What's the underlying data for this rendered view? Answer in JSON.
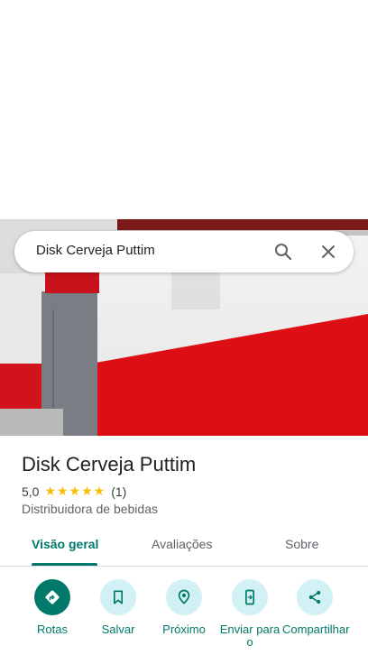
{
  "search": {
    "value": "Disk Cerveja Puttim"
  },
  "place": {
    "name": "Disk Cerveja Puttim",
    "rating": "5,0",
    "stars": "★★★★★",
    "review_count": "(1)",
    "category": "Distribuidora de bebidas"
  },
  "tabs": [
    {
      "label": "Visão geral",
      "active": true
    },
    {
      "label": "Avaliações",
      "active": false
    },
    {
      "label": "Sobre",
      "active": false
    }
  ],
  "actions": [
    {
      "label": "Rotas",
      "icon": "directions-icon"
    },
    {
      "label": "Salvar",
      "icon": "bookmark-icon"
    },
    {
      "label": "Próximo",
      "icon": "nearby-icon"
    },
    {
      "label": "Enviar para o",
      "icon": "send-to-phone-icon"
    },
    {
      "label": "Compartilhar",
      "icon": "share-icon"
    }
  ],
  "colors": {
    "accent": "#00796b",
    "action_bg": "#d2f1f4",
    "star": "#fbbc04"
  }
}
